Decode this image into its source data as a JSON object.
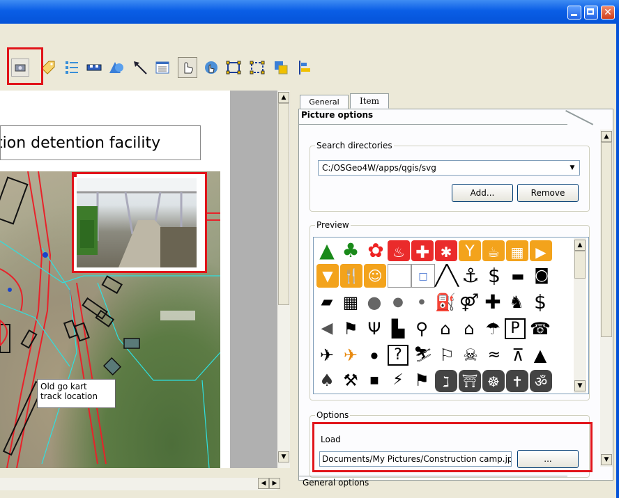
{
  "window": {
    "title": ""
  },
  "toolbar": {
    "items": [
      {
        "name": "add-picture",
        "icon": "picture-icon"
      },
      {
        "name": "add-label",
        "icon": "label-tag-icon"
      },
      {
        "name": "add-legend",
        "icon": "legend-list-icon"
      },
      {
        "name": "add-scalebar",
        "icon": "scalebar-icon"
      },
      {
        "name": "add-shape",
        "icon": "shape-icon"
      },
      {
        "name": "add-arrow",
        "icon": "arrow-icon"
      },
      {
        "name": "add-table",
        "icon": "table-icon"
      },
      {
        "name": "select-move-item",
        "icon": "pointer-hand-icon"
      },
      {
        "name": "move-item-content",
        "icon": "move-content-icon"
      },
      {
        "name": "group-items",
        "icon": "group-icon"
      },
      {
        "name": "ungroup-items",
        "icon": "ungroup-icon"
      },
      {
        "name": "raise-items",
        "icon": "raise-icon"
      },
      {
        "name": "align-items",
        "icon": "align-icon"
      }
    ]
  },
  "canvas": {
    "title_text": "tion detention facility",
    "label_text_1": "Old go kart",
    "label_text_2": "track location"
  },
  "panel": {
    "tabs": [
      {
        "label": "General"
      },
      {
        "label": "Item"
      }
    ],
    "section_title": "Picture options",
    "search_directories": {
      "group_label": "Search directories",
      "selected_path": "C:/OSGeo4W/apps/qgis/svg",
      "add_label": "Add...",
      "remove_label": "Remove"
    },
    "preview": {
      "group_label": "Preview"
    },
    "options": {
      "group_label": "Options",
      "load_label": "Load",
      "load_value": "Documents/My Pictures/Construction camp.jpg",
      "browse_label": "..."
    },
    "general_options": "General options"
  },
  "colors": {
    "highlight": "#e1141a",
    "titlebar": "#0a5ee6",
    "symbol_orange": "#f3a31c",
    "symbol_red": "#ea2b2b"
  }
}
